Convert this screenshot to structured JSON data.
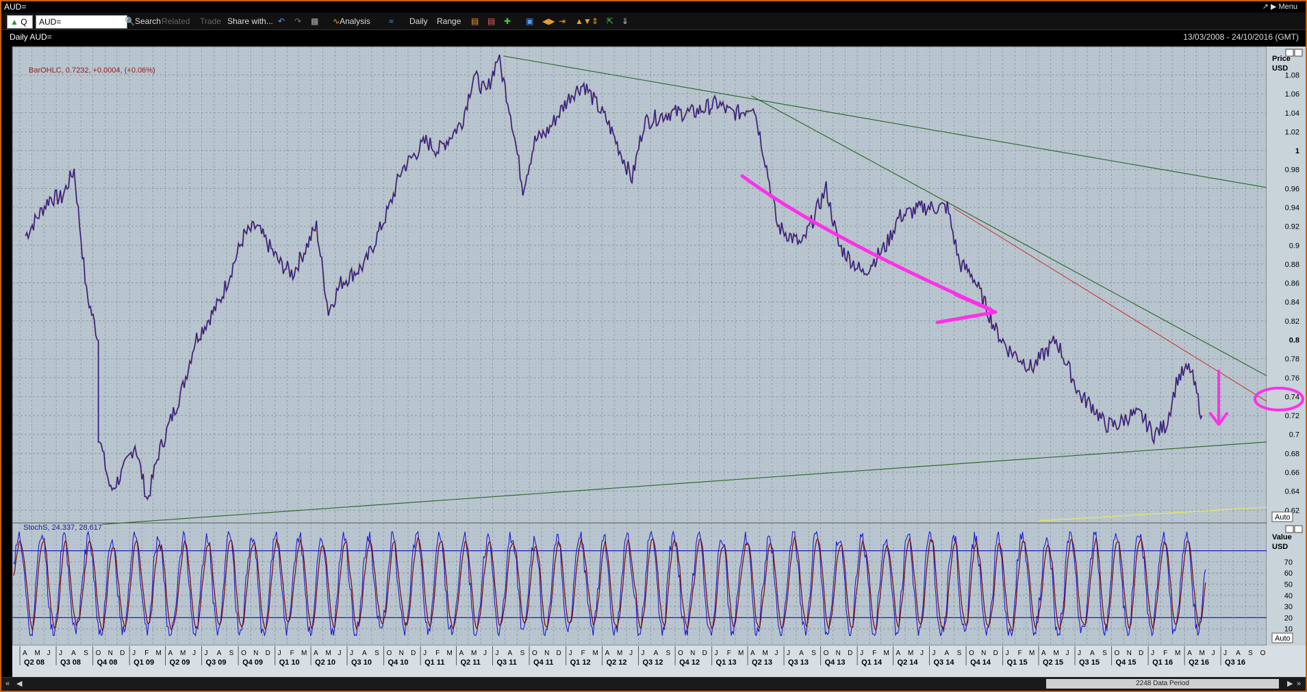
{
  "window": {
    "title": "AUD=",
    "menu_label": "Menu"
  },
  "toolbar": {
    "quote_type": "Q",
    "ric_value": "AUD=",
    "search_label": "Search",
    "related_label": "Related",
    "trade_label": "Trade",
    "share_label": "Share with...",
    "analysis_label": "Analysis",
    "interval_label": "Daily",
    "range_label": "Range"
  },
  "chart_header": {
    "title": "Daily AUD=",
    "date_range": "13/03/2008 - 24/10/2016 (GMT)"
  },
  "price_panel": {
    "legend": "BarOHLC, 0.7232, +0.0004, (+0.06%)",
    "axis_title": "Price",
    "axis_unit": "USD",
    "auto_label": "Auto"
  },
  "stoch_panel": {
    "legend": "StochS, 24.337, 28.617",
    "axis_title": "Value",
    "axis_unit": "USD",
    "auto_label": "Auto"
  },
  "scrollbar": {
    "label": "2248 Data Period"
  },
  "colors": {
    "price": "#1a1a9a",
    "price_down": "#7a1010",
    "trend": "#2e6b2e",
    "annotation": "#ff30e8",
    "red_trend": "#cc2b20",
    "yellow_line": "#e8e860",
    "bg": "#b8c6cf"
  },
  "chart_data": [
    {
      "type": "line",
      "title": "Daily AUD=",
      "ylabel": "Price USD",
      "ylim": [
        0.605,
        1.11
      ],
      "yticks": [
        1.08,
        1.06,
        1.04,
        1.02,
        1,
        0.98,
        0.96,
        0.94,
        0.92,
        0.9,
        0.88,
        0.86,
        0.84,
        0.82,
        0.8,
        0.78,
        0.76,
        0.74,
        0.72,
        0.7,
        0.68,
        0.66,
        0.64,
        0.62
      ],
      "x_month_letters": [
        "A",
        "M",
        "J",
        "J",
        "A",
        "S",
        "O",
        "N",
        "D",
        "J",
        "F",
        "M",
        "A",
        "M",
        "J",
        "J",
        "A",
        "S",
        "O",
        "N",
        "D",
        "J",
        "F",
        "M",
        "A",
        "M",
        "J",
        "J",
        "A",
        "S",
        "O",
        "N",
        "D",
        "J",
        "F",
        "M",
        "A",
        "M",
        "J",
        "J",
        "A",
        "S",
        "O",
        "N",
        "D",
        "J",
        "F",
        "M",
        "A",
        "M",
        "J",
        "J",
        "A",
        "S",
        "O",
        "N",
        "D",
        "J",
        "F",
        "M",
        "A",
        "M",
        "J",
        "J",
        "A",
        "S",
        "O",
        "N",
        "D",
        "J",
        "F",
        "M",
        "A",
        "M",
        "J",
        "J",
        "A",
        "S",
        "O",
        "N",
        "D",
        "J",
        "F",
        "M",
        "A",
        "M",
        "J",
        "J",
        "A",
        "S",
        "O",
        "N",
        "D",
        "J",
        "F",
        "M",
        "A",
        "M",
        "J",
        "J",
        "A",
        "S",
        "O"
      ],
      "x_quarters": [
        "Q2 08",
        "Q3 08",
        "Q4 08",
        "Q1 09",
        "Q2 09",
        "Q3 09",
        "Q4 09",
        "Q1 10",
        "Q2 10",
        "Q3 10",
        "Q4 10",
        "Q1 11",
        "Q2 11",
        "Q3 11",
        "Q4 11",
        "Q1 12",
        "Q2 12",
        "Q3 12",
        "Q4 12",
        "Q1 13",
        "Q2 13",
        "Q3 13",
        "Q4 13",
        "Q1 14",
        "Q2 14",
        "Q3 14",
        "Q4 14",
        "Q1 15",
        "Q2 15",
        "Q3 15",
        "Q4 15",
        "Q1 16",
        "Q2 16",
        "Q3 16"
      ],
      "series": [
        {
          "x": [
            "2008-04",
            "2008-06",
            "2008-07",
            "2008-08",
            "2008-09",
            "2008-10",
            "2008-10",
            "2008-11",
            "2008-12",
            "2009-01",
            "2009-02",
            "2009-03",
            "2009-05",
            "2009-06",
            "2009-08",
            "2009-10",
            "2009-11",
            "2010-01",
            "2010-02",
            "2010-04",
            "2010-05",
            "2010-06",
            "2010-08",
            "2010-10",
            "2010-11",
            "2011-01",
            "2011-02",
            "2011-04",
            "2011-05",
            "2011-06",
            "2011-07",
            "2011-08",
            "2011-09",
            "2011-10",
            "2011-11",
            "2012-01",
            "2012-02",
            "2012-04",
            "2012-06",
            "2012-07",
            "2012-09",
            "2012-11",
            "2013-01",
            "2013-02",
            "2013-03",
            "2013-04",
            "2013-05",
            "2013-06",
            "2013-08",
            "2013-10",
            "2013-11",
            "2014-01",
            "2014-03",
            "2014-04",
            "2014-06",
            "2014-08",
            "2014-09",
            "2014-10",
            "2014-11",
            "2014-12",
            "2015-01",
            "2015-02",
            "2015-03",
            "2015-05",
            "2015-06",
            "2015-07",
            "2015-08",
            "2015-09",
            "2015-10",
            "2015-11",
            "2015-12",
            "2016-01",
            "2016-02",
            "2016-03",
            "2016-04",
            "2016-05"
          ],
          "values": [
            0.91,
            0.95,
            0.95,
            0.98,
            0.85,
            0.8,
            0.7,
            0.64,
            0.66,
            0.69,
            0.63,
            0.68,
            0.75,
            0.8,
            0.84,
            0.91,
            0.92,
            0.88,
            0.87,
            0.92,
            0.83,
            0.86,
            0.88,
            0.94,
            0.98,
            1.01,
            1.0,
            1.03,
            1.08,
            1.06,
            1.1,
            1.04,
            0.96,
            1.01,
            1.02,
            1.06,
            1.07,
            1.03,
            0.97,
            1.03,
            1.04,
            1.04,
            1.05,
            1.04,
            1.04,
            1.05,
            0.99,
            0.92,
            0.9,
            0.96,
            0.9,
            0.87,
            0.9,
            0.93,
            0.94,
            0.94,
            0.88,
            0.87,
            0.84,
            0.81,
            0.79,
            0.78,
            0.77,
            0.8,
            0.77,
            0.74,
            0.73,
            0.71,
            0.71,
            0.72,
            0.72,
            0.7,
            0.71,
            0.76,
            0.77,
            0.72
          ]
        }
      ],
      "annotations": [
        "upper trendline Aug 2011 - Oct 2016",
        "lower trendline Oct 2008 - Oct 2016",
        "downward magenta arrow 2013-2014",
        "downward magenta arrow 2016",
        "magenta circle near 0.72"
      ]
    },
    {
      "type": "line",
      "title": "StochS",
      "ylabel": "Value USD",
      "ylim": [
        0,
        100
      ],
      "yticks": [
        70,
        60,
        50,
        40,
        30,
        20,
        10
      ],
      "reference_lines": [
        80,
        20
      ],
      "series": [
        {
          "name": "StochS %K",
          "last": 24.337
        },
        {
          "name": "StochS %D",
          "last": 28.617
        }
      ]
    }
  ]
}
